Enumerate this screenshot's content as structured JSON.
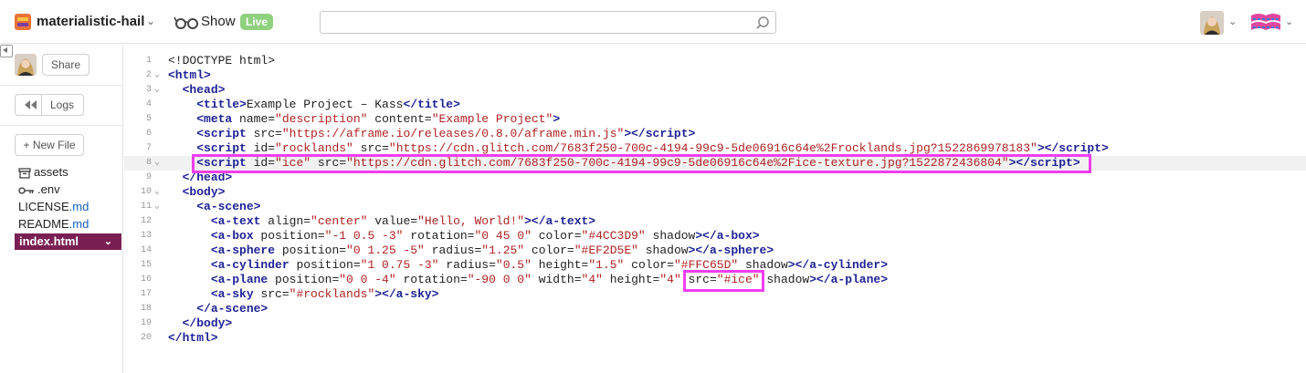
{
  "header": {
    "project_name": "materialistic-hail",
    "show_label": "Show",
    "live_badge": "Live",
    "search_placeholder": ""
  },
  "sidebar": {
    "share_label": "Share",
    "logs_label": "Logs",
    "new_file_label": "+ New File",
    "files": [
      {
        "name": "assets",
        "icon": "archive-icon"
      },
      {
        "name": ".env",
        "icon": "key-icon"
      },
      {
        "name": "LICENSE",
        "ext": ".md"
      },
      {
        "name": "README",
        "ext": ".md"
      },
      {
        "name": "index",
        "ext": ".html",
        "selected": true
      }
    ]
  },
  "editor": {
    "active_line": 8,
    "lines": [
      {
        "n": "1",
        "html": "&lt;!DOCTYPE html&gt;"
      },
      {
        "n": "2",
        "fold": true,
        "html": "<span class='t'>&lt;html&gt;</span>"
      },
      {
        "n": "3",
        "fold": true,
        "html": "  <span class='t'>&lt;head&gt;</span>"
      },
      {
        "n": "4",
        "html": "    <span class='t'>&lt;title&gt;</span>Example Project – Kass<span class='t'>&lt;/title&gt;</span>"
      },
      {
        "n": "5",
        "html": "    <span class='t'>&lt;meta</span> name=<span class='s'>\"description\"</span> content=<span class='s'>\"Example Project\"</span><span class='t'>&gt;</span>"
      },
      {
        "n": "6",
        "html": "    <span class='t'>&lt;script</span> src=<span class='s'>\"https://aframe.io/releases/0.8.0/aframe.min.js\"</span><span class='t'>&gt;&lt;/script&gt;</span>"
      },
      {
        "n": "7",
        "html": "    <span class='t'>&lt;script</span> id=<span class='s'>\"rocklands\"</span> src=<span class='s'>\"https://cdn.glitch.com/7683f250-700c-4194-99c9-5de06916c64e%2Frocklands.jpg?1522869978183\"</span><span class='t'>&gt;&lt;/script&gt;</span>"
      },
      {
        "n": "8",
        "fold": true,
        "html": "    <span class='t'>&lt;script</span> id=<span class='s'>\"ice\"</span> src=<span class='s'>\"https://cdn.glitch.com/7683f250-700c-4194-99c9-5de06916c64e%2Fice-texture.jpg?1522872436804\"</span><span class='t'>&gt;&lt;/script&gt;</span>"
      },
      {
        "n": "9",
        "html": "  <span class='t'>&lt;/head&gt;</span>"
      },
      {
        "n": "10",
        "fold": true,
        "html": "  <span class='t'>&lt;body&gt;</span>"
      },
      {
        "n": "11",
        "fold": true,
        "html": "    <span class='t'>&lt;a-scene&gt;</span>"
      },
      {
        "n": "12",
        "html": "      <span class='t'>&lt;a-text</span> align=<span class='s'>\"center\"</span> value=<span class='s'>\"Hello, World!\"</span><span class='t'>&gt;&lt;/a-text&gt;</span>"
      },
      {
        "n": "13",
        "html": "      <span class='t'>&lt;a-box</span> position=<span class='s'>\"-1 0.5 -3\"</span> rotation=<span class='s'>\"0 45 0\"</span> color=<span class='s'>\"#4CC3D9\"</span> shadow<span class='t'>&gt;&lt;/a-box&gt;</span>"
      },
      {
        "n": "14",
        "html": "      <span class='t'>&lt;a-sphere</span> position=<span class='s'>\"0 1.25 -5\"</span> radius=<span class='s'>\"1.25\"</span> color=<span class='s'>\"#EF2D5E\"</span> shadow<span class='t'>&gt;&lt;/a-sphere&gt;</span>"
      },
      {
        "n": "15",
        "html": "      <span class='t'>&lt;a-cylinder</span> position=<span class='s'>\"1 0.75 -3\"</span> radius=<span class='s'>\"0.5\"</span> height=<span class='s'>\"1.5\"</span> color=<span class='s'>\"#FFC65D\"</span> shadow<span class='t'>&gt;&lt;/a-cylinder&gt;</span>"
      },
      {
        "n": "16",
        "html": "      <span class='t'>&lt;a-plane</span> position=<span class='s'>\"0 0 -4\"</span> rotation=<span class='s'>\"-90 0 0\"</span> width=<span class='s'>\"4\"</span> height=<span class='s'>\"4\"</span> src=<span class='s'>\"#ice\"</span> shadow<span class='t'>&gt;&lt;/a-plane&gt;</span>"
      },
      {
        "n": "17",
        "html": "      <span class='t'>&lt;a-sky</span> src=<span class='s'>\"#rocklands\"</span><span class='t'>&gt;&lt;/a-sky&gt;</span>"
      },
      {
        "n": "18",
        "html": "    <span class='t'>&lt;/a-scene&gt;</span>"
      },
      {
        "n": "19",
        "html": "  <span class='t'>&lt;/body&gt;</span>"
      },
      {
        "n": "20",
        "html": "<span class='t'>&lt;/html&gt;</span>"
      }
    ]
  },
  "colors": {
    "accent": "#7a1f53",
    "highlight": "#f03ef0",
    "tag": "#1f2396",
    "string": "#b02323",
    "live": "#8fd17e"
  }
}
